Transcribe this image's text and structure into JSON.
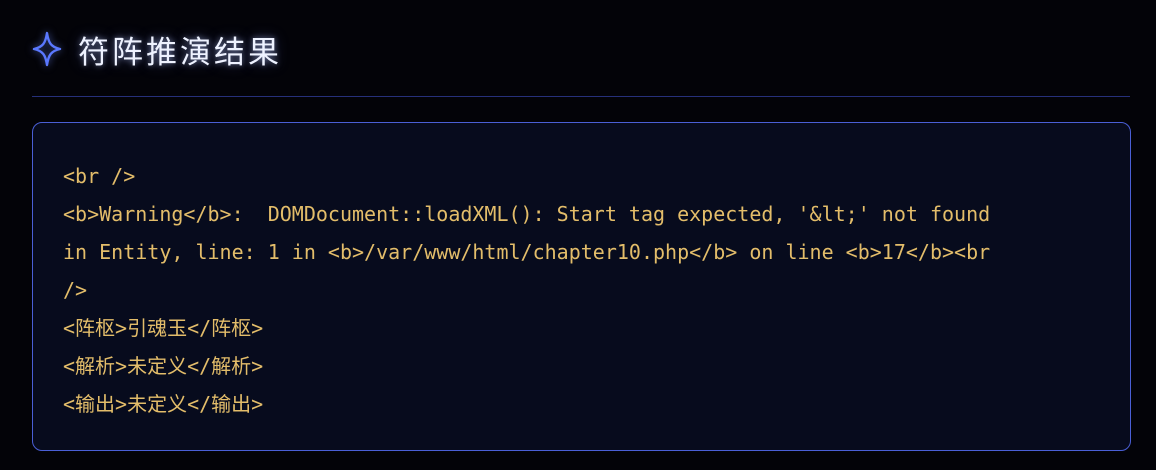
{
  "header": {
    "title": "符阵推演结果",
    "icon": "diamond-sparkle-icon",
    "accent_color": "#5a78ff"
  },
  "result": {
    "lines": [
      "<br />",
      "<b>Warning</b>:  DOMDocument::loadXML(): Start tag expected, '&lt;' not found",
      "in Entity, line: 1 in <b>/var/www/html/chapter10.php</b> on line <b>17</b><br",
      "/>",
      "<阵枢>引魂玉</阵枢>",
      "<解析>未定义</解析>",
      "<输出>未定义</输出>"
    ],
    "text_color": "#e3bd6a",
    "border_color": "#4a5fd6"
  }
}
